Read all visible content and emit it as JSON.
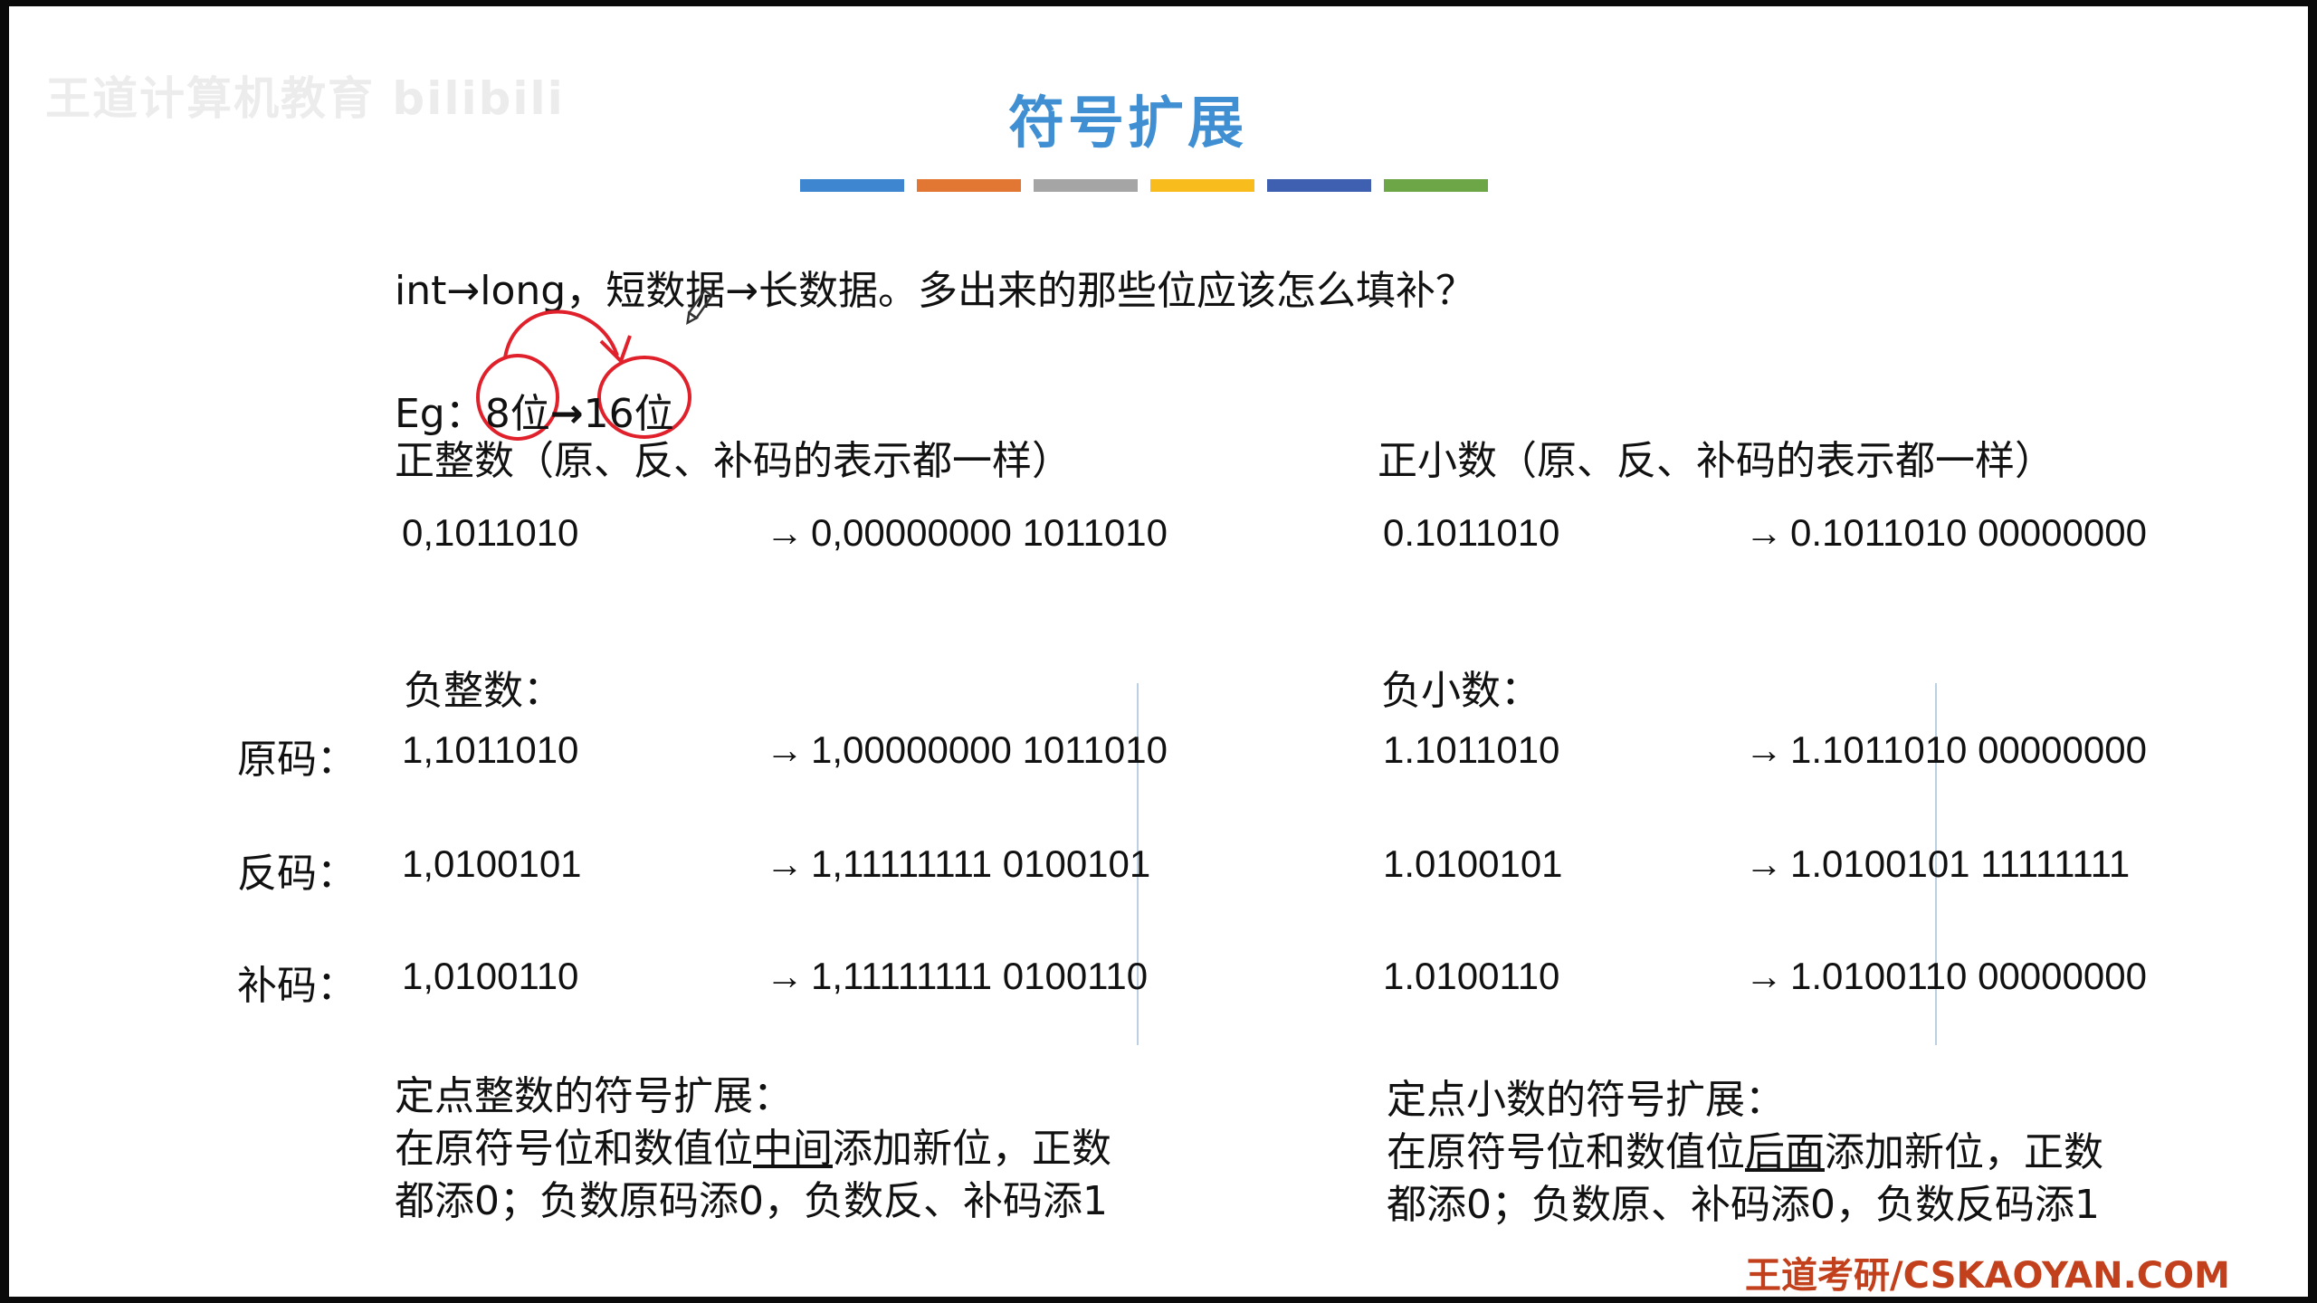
{
  "watermark": "王道计算机教育 bilibili",
  "title": "符号扩展",
  "title_bars": [
    "#3f86d1",
    "#e27733",
    "#a5a5a5",
    "#f8bd1c",
    "#3f5fb0",
    "#6da646"
  ],
  "question": "int→long，短数据→长数据。多出来的那些位应该怎么填补？",
  "eg": {
    "label": "Eg：",
    "from": "8位",
    "arrow": "→",
    "to": "16位"
  },
  "positive": {
    "int_heading": "正整数（原、反、补码的表示都一样）",
    "int_from": "0,1011010",
    "int_to": "0,00000000 1011010",
    "frac_heading": "正小数（原、反、补码的表示都一样）",
    "frac_from": "0.1011010",
    "frac_to": "0.1011010 00000000"
  },
  "negative": {
    "int_heading": "负整数：",
    "frac_heading": "负小数：",
    "rows": [
      {
        "label": "原码：",
        "int_from": "1,1011010",
        "int_to": "1,00000000 1011010",
        "frac_from": "1.1011010",
        "frac_to": "1.1011010 00000000"
      },
      {
        "label": "反码：",
        "int_from": "1,0100101",
        "int_to": "1,11111111 0100101",
        "frac_from": "1.0100101",
        "frac_to": "1.0100101 11111111"
      },
      {
        "label": "补码：",
        "int_from": "1,0100110",
        "int_to": "1,11111111 0100110",
        "frac_from": "1.0100110",
        "frac_to": "1.0100110 00000000"
      }
    ]
  },
  "arrow_glyph": "→",
  "summary_int": {
    "heading": "定点整数的符号扩展：",
    "line1_pre": "在原符号位和数值位",
    "line1_ul": "中间",
    "line1_post": "添加新位，正数",
    "line2": "都添0；负数原码添0，负数反、补码添1"
  },
  "summary_frac": {
    "heading": "定点小数的符号扩展：",
    "line1_pre": "在原符号位和数值位",
    "line1_ul": "后面",
    "line1_post": "添加新位，正数",
    "line2": "都添0；负数原、补码添0，负数反码添1"
  },
  "footer": "王道考研/CSKAOYAN.COM",
  "annotation_color": "#e0202a"
}
